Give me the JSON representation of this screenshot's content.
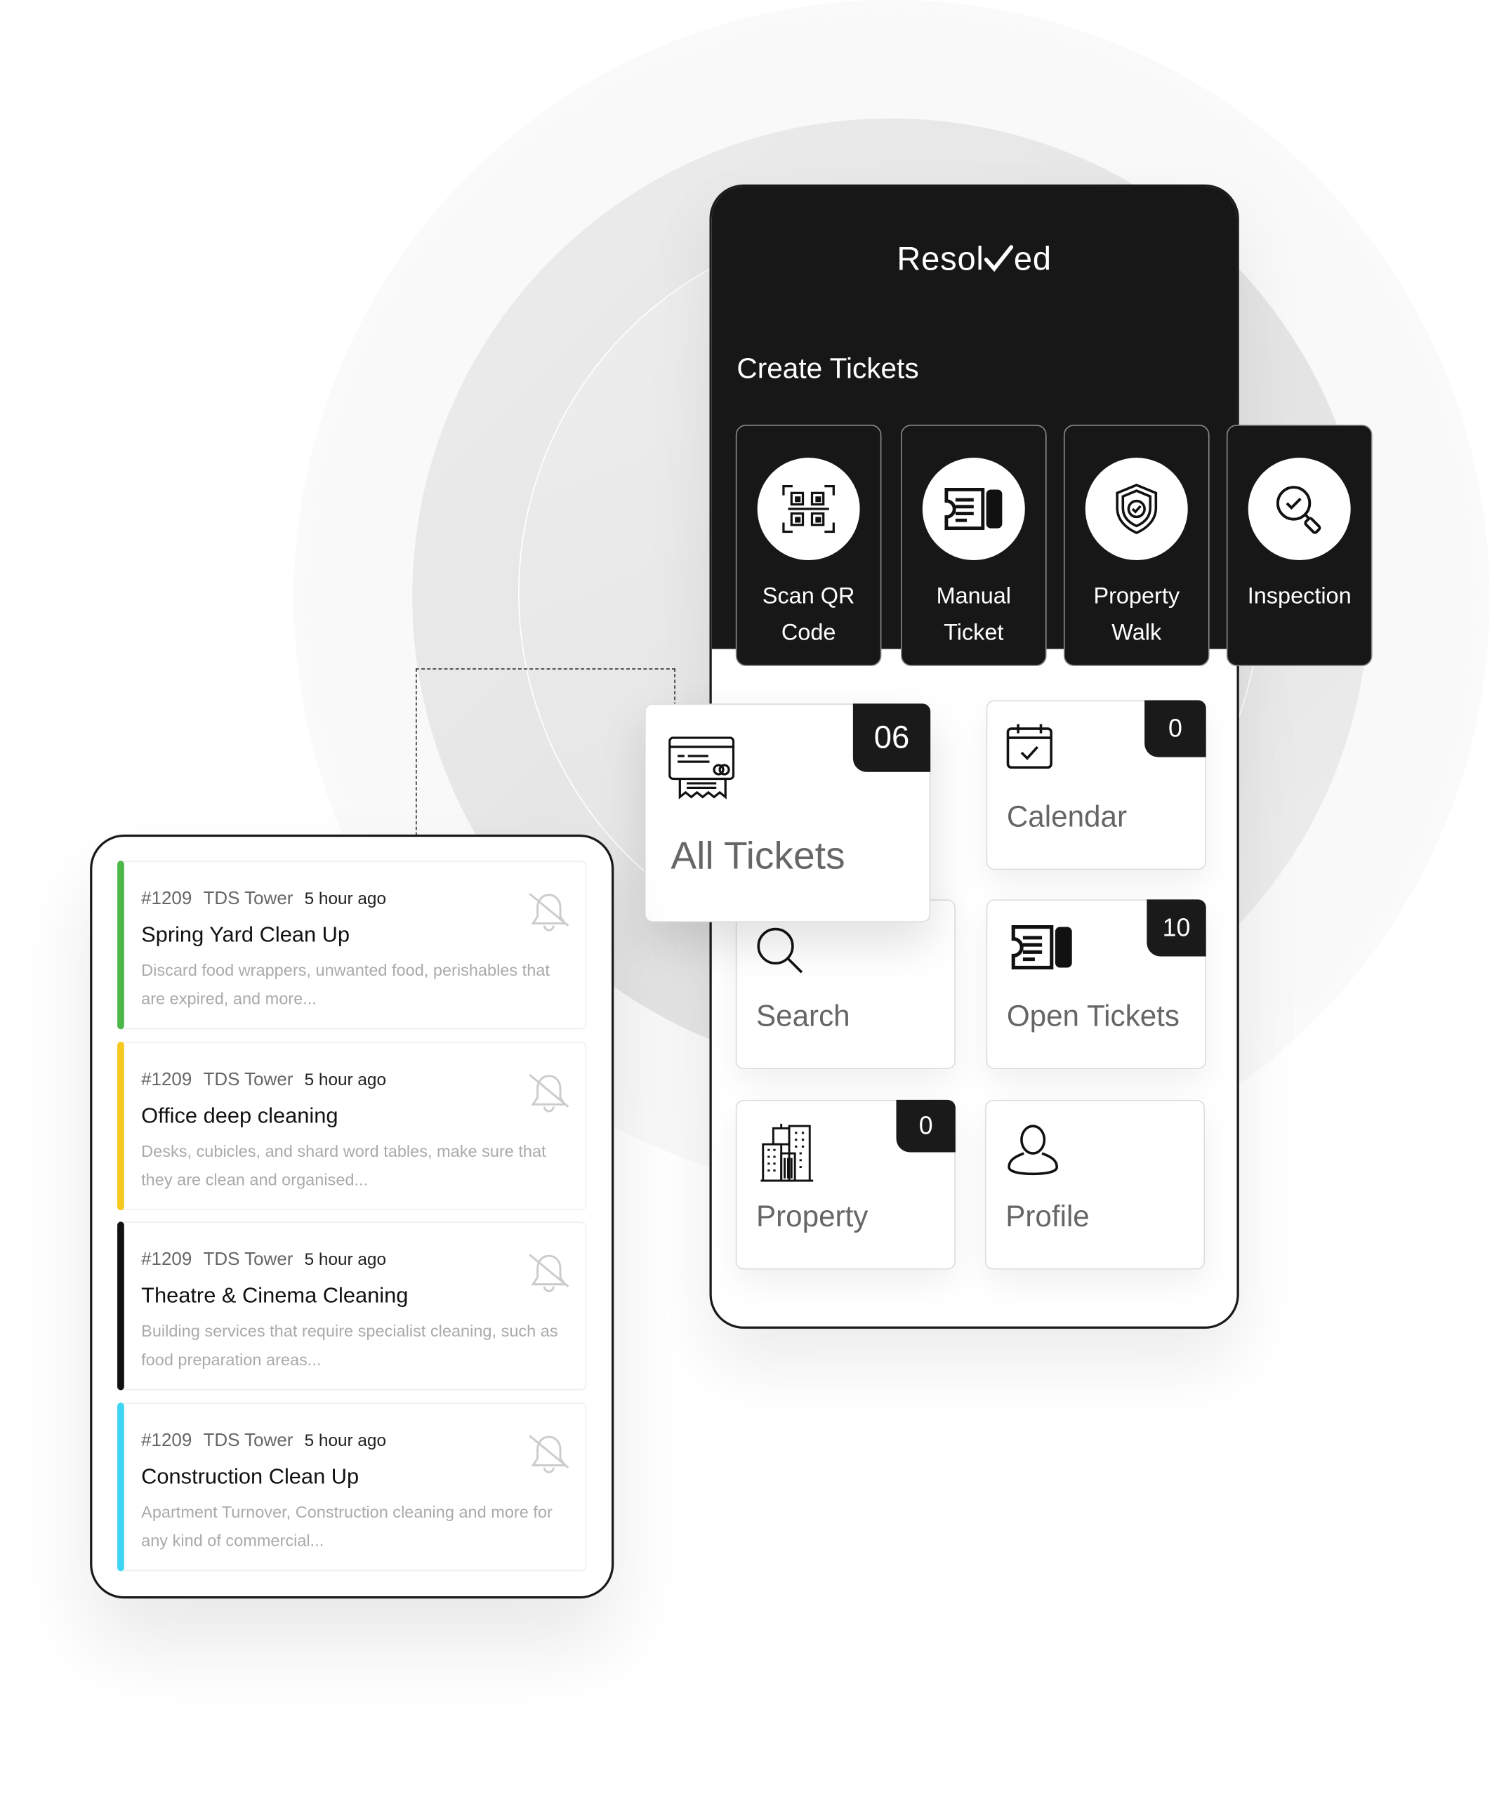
{
  "colors": {
    "dark": "#171717",
    "green": "#4cb848",
    "yellow": "#f7c81e",
    "black": "#111111",
    "cyan": "#3dd5f3"
  },
  "app": {
    "logo": "Resolved",
    "logo_left": "Resol",
    "logo_right": "ed"
  },
  "create": {
    "title": "Create Tickets",
    "actions": [
      {
        "label_1": "Scan QR",
        "label_2": "Code",
        "icon": "qr-code-icon"
      },
      {
        "label_1": "Manual",
        "label_2": "Ticket",
        "icon": "ticket-icon"
      },
      {
        "label_1": "Property",
        "label_2": "Walk",
        "icon": "shield-check-icon"
      },
      {
        "label_1": "Inspection",
        "label_2": "",
        "icon": "magnifier-check-icon"
      }
    ]
  },
  "tiles": {
    "all_tickets": {
      "label": "All Tickets",
      "count": "06",
      "icon": "receipt-card-icon"
    },
    "calendar": {
      "label": "Calendar",
      "count": "0",
      "icon": "calendar-check-icon"
    },
    "search": {
      "label": "Search",
      "icon": "search-icon"
    },
    "open_tickets": {
      "label": "Open Tickets",
      "count": "10",
      "icon": "ticket-icon"
    },
    "property": {
      "label": "Property",
      "count": "0",
      "icon": "buildings-icon"
    },
    "profile": {
      "label": "Profile",
      "icon": "user-icon"
    }
  },
  "tickets": [
    {
      "id": "#1209",
      "location": "TDS Tower",
      "time": "5 hour ago",
      "title": "Spring Yard Clean Up",
      "desc": "Discard food wrappers, unwanted food, perishables that are expired, and more...",
      "color": "#4cb848"
    },
    {
      "id": "#1209",
      "location": "TDS Tower",
      "time": "5 hour ago",
      "title": "Office deep cleaning",
      "desc": "Desks, cubicles, and shard word tables, make sure that they are clean and organised...",
      "color": "#f7c81e"
    },
    {
      "id": "#1209",
      "location": "TDS Tower",
      "time": "5 hour ago",
      "title": "Theatre & Cinema Cleaning",
      "desc": "Building services that require specialist cleaning, such as food preparation areas...",
      "color": "#111111"
    },
    {
      "id": "#1209",
      "location": "TDS Tower",
      "time": "5 hour ago",
      "title": "Construction Clean Up",
      "desc": "Apartment Turnover, Construction cleaning and more for any kind of commercial...",
      "color": "#3dd5f3"
    }
  ]
}
